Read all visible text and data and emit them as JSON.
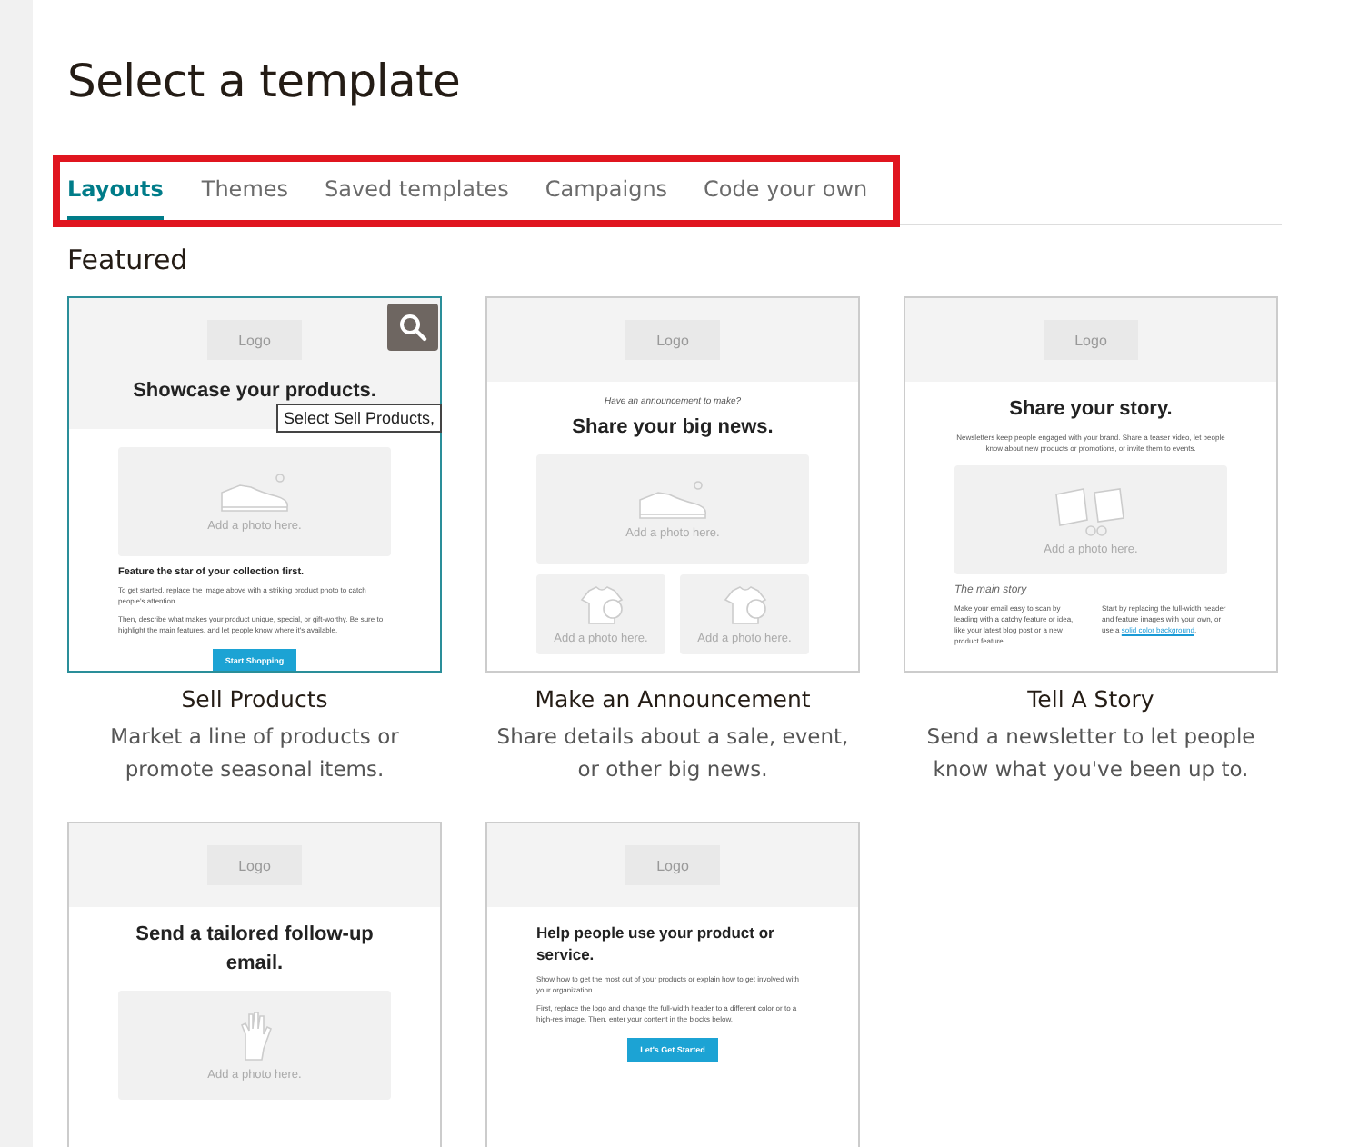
{
  "title": "Select a template",
  "tabs_highlighted": true,
  "tabs": [
    {
      "label": "Layouts",
      "selected": true
    },
    {
      "label": "Themes",
      "selected": false
    },
    {
      "label": "Saved templates",
      "selected": false
    },
    {
      "label": "Campaigns",
      "selected": false
    },
    {
      "label": "Code your own",
      "selected": false
    }
  ],
  "section": "Featured",
  "templates": [
    {
      "name": "Sell Products",
      "description": "Market a line of products or promote seasonal items.",
      "selected": true,
      "tooltip": "Select Sell Products,",
      "thumbnail": {
        "header": [
          {
            "kind": "logo",
            "text": "Logo"
          },
          {
            "kind": "heading",
            "text": "Showcase your products."
          }
        ],
        "body": [
          {
            "kind": "photo",
            "text": "Add a photo here."
          },
          {
            "kind": "subhead",
            "text": "Feature the star of your collection first."
          },
          {
            "kind": "text",
            "text": "To get started, replace the image above with a striking product photo to catch people's attention."
          },
          {
            "kind": "text",
            "text": "Then, describe what makes your product unique, special, or gift-worthy. Be sure to highlight the main features, and let people know where it's available."
          },
          {
            "kind": "button",
            "text": "Start Shopping"
          }
        ]
      }
    },
    {
      "name": "Make an Announcement",
      "description": "Share details about a sale, event, or other big news.",
      "selected": false,
      "thumbnail": {
        "header": [
          {
            "kind": "logo",
            "text": "Logo"
          }
        ],
        "body": [
          {
            "kind": "kicker",
            "text": "Have an announcement to make?"
          },
          {
            "kind": "heading",
            "text": "Share your big news."
          },
          {
            "kind": "photo",
            "text": "Add a photo here."
          },
          {
            "kind": "photo-pair",
            "text": "Add a photo here.",
            "text_2": "Add a photo here."
          }
        ]
      }
    },
    {
      "name": "Tell A Story",
      "description": "Send a newsletter to let people know what you've been up to.",
      "selected": false,
      "thumbnail": {
        "header": [
          {
            "kind": "logo",
            "text": "Logo"
          }
        ],
        "body": [
          {
            "kind": "heading",
            "text": "Share your story."
          },
          {
            "kind": "text-center",
            "text": "Newsletters keep people engaged with your brand. Share a teaser video, let people know about new products or promotions, or invite them to events."
          },
          {
            "kind": "photo",
            "text": "Add a photo here."
          },
          {
            "kind": "kicker-left",
            "text": "The main story"
          },
          {
            "kind": "columns",
            "text": "Make your email easy to scan by leading with a catchy feature or idea, like your latest blog post or a new product feature.",
            "text_2": "Start by replacing the full-width header and feature images with your own, or use a",
            "link": "solid color background",
            "after": "."
          }
        ]
      }
    },
    {
      "selected": false,
      "thumbnail": {
        "header": [
          {
            "kind": "logo",
            "text": "Logo"
          }
        ],
        "body": [
          {
            "kind": "heading",
            "text": "Send a tailored follow-up email."
          },
          {
            "kind": "photo",
            "text": "Add a photo here."
          }
        ]
      }
    },
    {
      "selected": false,
      "thumbnail": {
        "header": [
          {
            "kind": "logo",
            "text": "Logo"
          }
        ],
        "body": [
          {
            "kind": "heading-left",
            "text": "Help people use your product or service."
          },
          {
            "kind": "text",
            "text": "Show how to get the most out of your products or explain how to get involved with your organization."
          },
          {
            "kind": "text",
            "text": "First, replace the logo and change the full-width header to a different color or to a high-res image. Then, enter your content in the blocks below."
          },
          {
            "kind": "button",
            "text": "Let's Get Started"
          }
        ]
      }
    }
  ]
}
